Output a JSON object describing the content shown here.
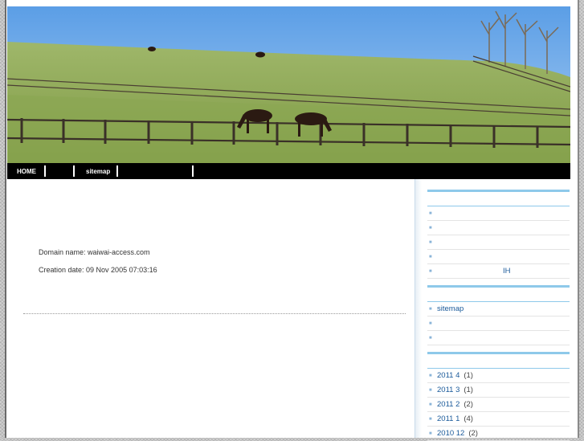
{
  "header": {
    "image_alt": "horse pasture banner"
  },
  "nav": {
    "home": "HOME",
    "blank1": "",
    "sitemap": "sitemap",
    "blank2": ""
  },
  "main": {
    "domain_line": "Domain name: waiwai-access.com",
    "creation_line": "Creation date: 09 Nov 2005 07:03:16"
  },
  "sidebar": {
    "group1": [
      {
        "label": ""
      },
      {
        "label": ""
      },
      {
        "label": ""
      },
      {
        "label": ""
      },
      {
        "label": "",
        "suffix": "IH"
      }
    ],
    "group2": [
      {
        "label": "sitemap"
      },
      {
        "label": ""
      },
      {
        "label": ""
      }
    ],
    "archives": [
      {
        "label": "2011 4",
        "count": "(1)"
      },
      {
        "label": "2011 3",
        "count": "(1)"
      },
      {
        "label": "2011 2",
        "count": "(2)"
      },
      {
        "label": "2011 1",
        "count": "(4)"
      },
      {
        "label": "2010 12",
        "count": "(2)"
      }
    ]
  },
  "colors": {
    "accent": "#8ec9ea",
    "link": "#1a5a9a",
    "nav_bg": "#000000"
  }
}
